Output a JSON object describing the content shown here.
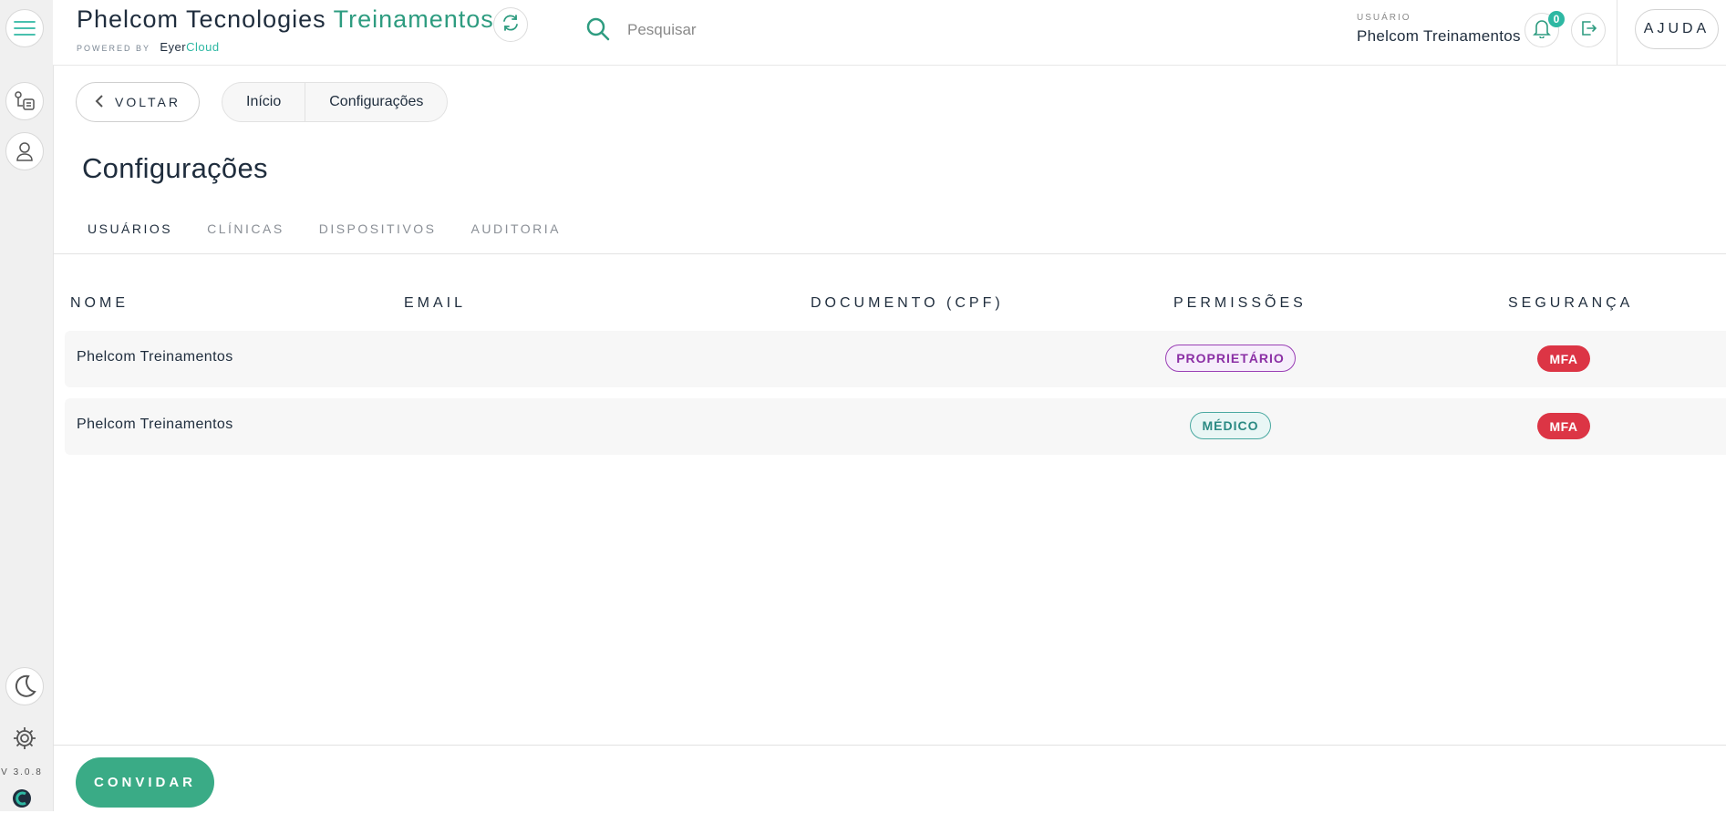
{
  "app": {
    "title_main": "Phelcom Tecnologies",
    "title_accent": "Treinamentos",
    "powered_by": "POWERED BY",
    "powered_brand_a": "Eyer",
    "powered_brand_b": "Cloud",
    "version": "V 3.0.8"
  },
  "search": {
    "placeholder": "Pesquisar"
  },
  "user": {
    "caption": "USUÁRIO",
    "name": "Phelcom Treinamentos",
    "notifications": "0"
  },
  "header": {
    "help_label": "AJUDA"
  },
  "nav": {
    "back_label": "VOLTAR",
    "breadcrumb": [
      "Início",
      "Configurações"
    ]
  },
  "page": {
    "title": "Configurações"
  },
  "tabs": [
    {
      "label": "USUÁRIOS",
      "active": true
    },
    {
      "label": "CLÍNICAS",
      "active": false
    },
    {
      "label": "DISPOSITIVOS",
      "active": false
    },
    {
      "label": "AUDITORIA",
      "active": false
    }
  ],
  "table": {
    "columns": [
      "NOME",
      "EMAIL",
      "DOCUMENTO (CPF)",
      "PERMISSÕES",
      "SEGURANÇA"
    ],
    "rows": [
      {
        "name": "Phelcom Treinamentos",
        "email": "",
        "document": "",
        "permission": "PROPRIETÁRIO",
        "security": "MFA"
      },
      {
        "name": "Phelcom Treinamentos",
        "email": "",
        "document": "",
        "permission": "MÉDICO",
        "security": "MFA"
      }
    ]
  },
  "footer": {
    "invite_label": "CONVIDAR"
  },
  "colors": {
    "accent": "#2e9c80",
    "primary_button": "#3aab86",
    "owner_badge": "#8b2fa5",
    "doctor_badge": "#2b8a83",
    "mfa_badge": "#dc3545"
  }
}
